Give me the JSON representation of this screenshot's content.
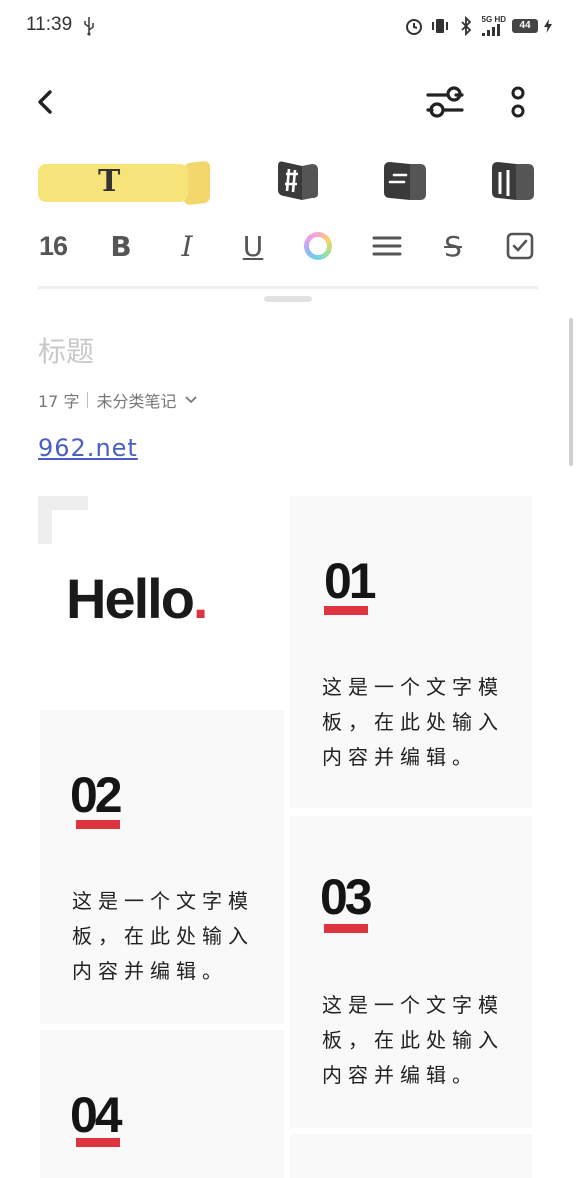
{
  "status_bar": {
    "time": "11:39",
    "network_label_top": "5G HD",
    "battery": "44"
  },
  "icons": {
    "back": "chevron-left-icon",
    "settings": "sliders-icon",
    "more": "vertical-dots-icon"
  },
  "toolbar": {
    "tabs": [
      {
        "label": "T",
        "icon": "text-tab",
        "active": true
      },
      {
        "icon": "hashtag-tab"
      },
      {
        "icon": "list-tab"
      },
      {
        "icon": "layout-tab"
      }
    ],
    "format": {
      "font_size": "16",
      "bold": "B",
      "italic": "I",
      "underline": "U",
      "strikethrough": "S"
    }
  },
  "note": {
    "title_placeholder": "标题",
    "char_count": "17 字",
    "category": "未分类笔记",
    "link": "962.net"
  },
  "template": {
    "hello": "Hello",
    "hello_dot": ".",
    "accent_color": "#dd3440",
    "cards": [
      {
        "number": "01",
        "text": "这是一个文字模板，在此处输入内容并编辑。"
      },
      {
        "number": "02",
        "text": "这是一个文字模板，在此处输入内容并编辑。"
      },
      {
        "number": "03",
        "text": "这是一个文字模板，在此处输入内容并编辑。"
      },
      {
        "number": "04",
        "text": ""
      }
    ]
  }
}
